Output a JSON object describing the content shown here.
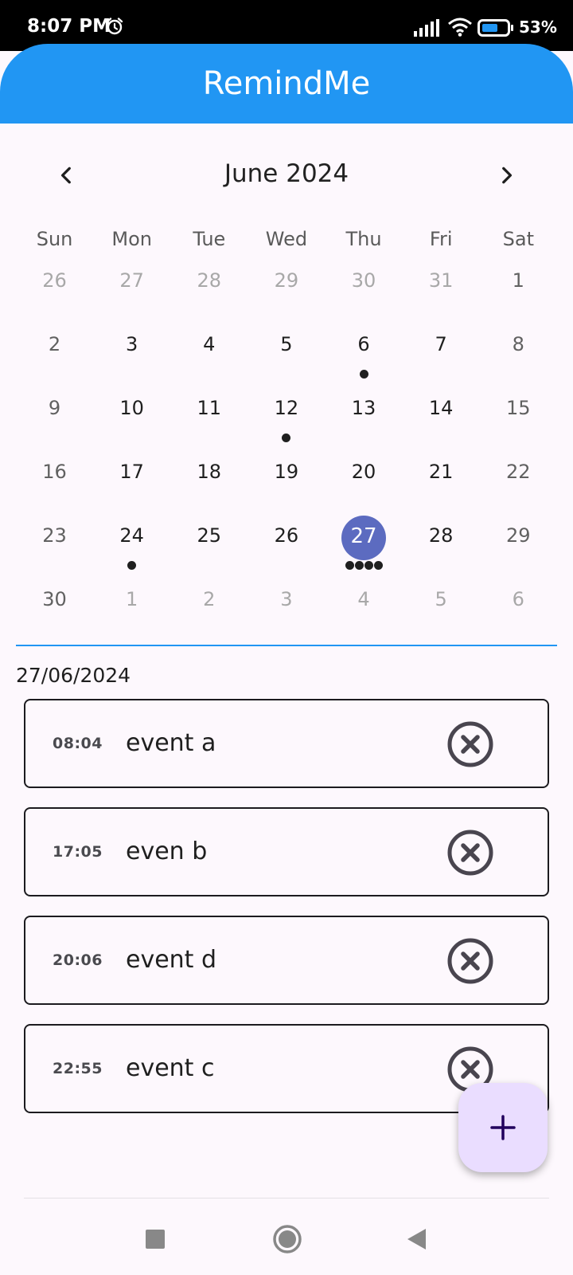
{
  "status_bar": {
    "time": "8:07 PM",
    "battery": "53%"
  },
  "app_bar": {
    "title": "RemindMe"
  },
  "calendar": {
    "month_title": "June 2024",
    "weekdays": [
      "Sun",
      "Mon",
      "Tue",
      "Wed",
      "Thu",
      "Fri",
      "Sat"
    ],
    "weeks": [
      [
        {
          "d": "26",
          "out": true
        },
        {
          "d": "27",
          "out": true
        },
        {
          "d": "28",
          "out": true
        },
        {
          "d": "29",
          "out": true
        },
        {
          "d": "30",
          "out": true
        },
        {
          "d": "31",
          "out": true
        },
        {
          "d": "1"
        }
      ],
      [
        {
          "d": "2"
        },
        {
          "d": "3"
        },
        {
          "d": "4"
        },
        {
          "d": "5"
        },
        {
          "d": "6",
          "markers": 1
        },
        {
          "d": "7"
        },
        {
          "d": "8"
        }
      ],
      [
        {
          "d": "9"
        },
        {
          "d": "10"
        },
        {
          "d": "11"
        },
        {
          "d": "12",
          "markers": 1
        },
        {
          "d": "13"
        },
        {
          "d": "14"
        },
        {
          "d": "15"
        }
      ],
      [
        {
          "d": "16"
        },
        {
          "d": "17"
        },
        {
          "d": "18"
        },
        {
          "d": "19"
        },
        {
          "d": "20"
        },
        {
          "d": "21"
        },
        {
          "d": "22"
        }
      ],
      [
        {
          "d": "23"
        },
        {
          "d": "24",
          "markers": 1
        },
        {
          "d": "25"
        },
        {
          "d": "26"
        },
        {
          "d": "27",
          "selected": true,
          "markers": 4
        },
        {
          "d": "28"
        },
        {
          "d": "29"
        }
      ],
      [
        {
          "d": "30"
        },
        {
          "d": "1",
          "out": true
        },
        {
          "d": "2",
          "out": true
        },
        {
          "d": "3",
          "out": true
        },
        {
          "d": "4",
          "out": true
        },
        {
          "d": "5",
          "out": true
        },
        {
          "d": "6",
          "out": true
        }
      ]
    ]
  },
  "selected_date": "27/06/2024",
  "events": [
    {
      "time": "08:04",
      "name": "event a"
    },
    {
      "time": "17:05",
      "name": "even b"
    },
    {
      "time": "20:06",
      "name": "event d"
    },
    {
      "time": "22:55",
      "name": "event c"
    }
  ],
  "colors": {
    "app_bar": "#2196f3",
    "selected_day": "#5c6bc0",
    "fab": "#eaddff"
  }
}
